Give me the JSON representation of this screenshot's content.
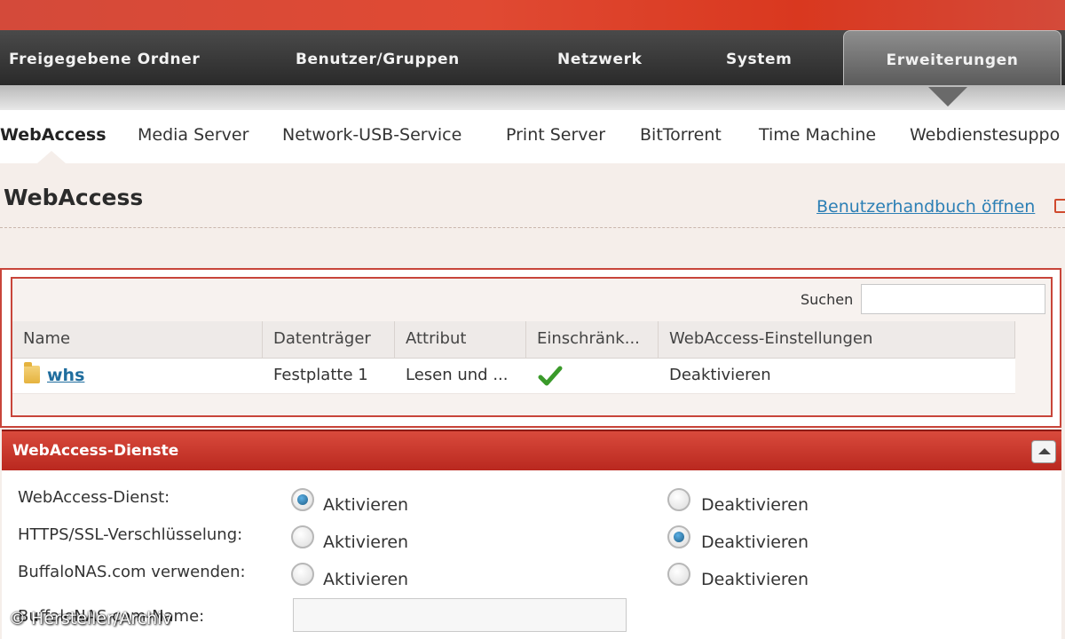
{
  "nav": {
    "items": [
      "Freigegebene Ordner",
      "Benutzer/Gruppen",
      "Netzwerk",
      "System",
      "Erweiterungen"
    ]
  },
  "subnav": {
    "items": [
      "WebAccess",
      "Media Server",
      "Network-USB-Service",
      "Print Server",
      "BitTorrent",
      "Time Machine",
      "Webdienstesuppo"
    ]
  },
  "page": {
    "title": "WebAccess",
    "manual_link": "Benutzerhandbuch öffnen"
  },
  "search": {
    "label": "Suchen",
    "value": ""
  },
  "table": {
    "columns": [
      "Name",
      "Datenträger",
      "Attribut",
      "Einschränk...",
      "WebAccess-Einstellungen"
    ],
    "rows": [
      {
        "name": "whs",
        "drive": "Festplatte 1",
        "attribute": "Lesen und ...",
        "restricted": true,
        "setting": "Deaktivieren"
      }
    ]
  },
  "services": {
    "title": "WebAccess-Dienste",
    "rows": [
      {
        "label": "WebAccess-Dienst:",
        "option_on": "Aktivieren",
        "option_off": "Deaktivieren",
        "selected": "on"
      },
      {
        "label": "HTTPS/SSL-Verschlüsselung:",
        "option_on": "Aktivieren",
        "option_off": "Deaktivieren",
        "selected": "off"
      },
      {
        "label": "BuffaloNAS.com verwenden:",
        "option_on": "Aktivieren",
        "option_off": "Deaktivieren",
        "selected": "off"
      }
    ],
    "name_field_label": "BuffaloNAS.com-Name:",
    "name_field_value": ""
  },
  "watermark": "© Hersteller/Archiv",
  "colors": {
    "accent_red": "#c8453a",
    "link_blue": "#2c7fb5",
    "check_green": "#3a9a2a"
  }
}
